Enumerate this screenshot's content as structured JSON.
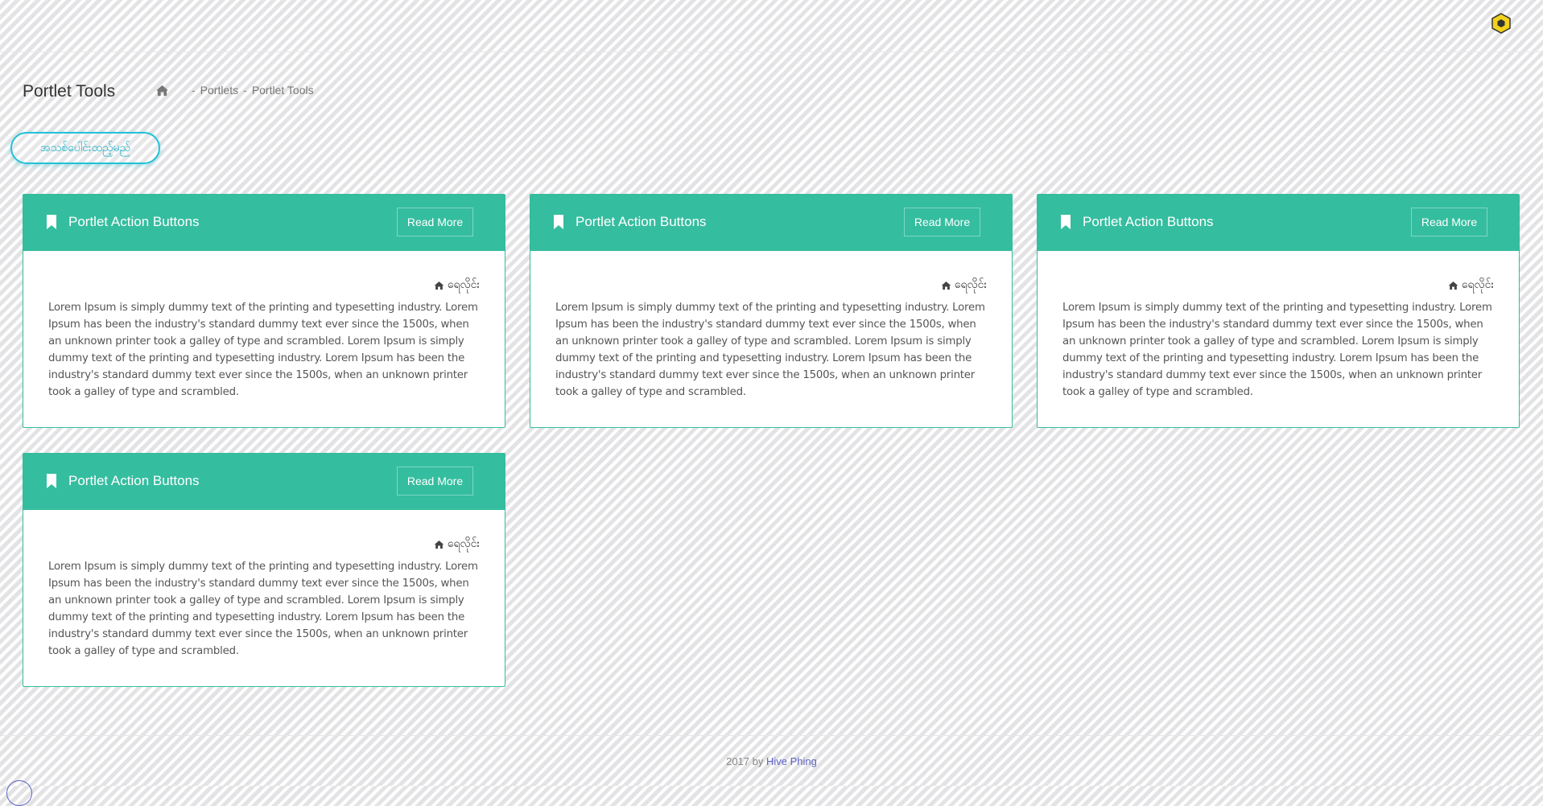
{
  "header": {
    "logo_icon": "hexagon-icon",
    "accent": "#f2d21b"
  },
  "page": {
    "title": "Portlet Tools",
    "breadcrumb": {
      "home_icon": "home-icon",
      "separator": "-",
      "items": [
        "Portlets",
        "Portlet Tools"
      ]
    },
    "action_button": "အသစ်ပေါင်းထည့်မည်"
  },
  "colors": {
    "card_header": "#35bd9f",
    "pill_border": "#22c2d6",
    "link": "#5d63c4"
  },
  "cards": [
    {
      "title": "Portlet Action Buttons",
      "button": "Read More",
      "home_label": "ရေလိုင်း",
      "text": "Lorem Ipsum is simply dummy text of the printing and typesetting industry. Lorem Ipsum has been the industry's standard dummy text ever since the 1500s, when an unknown printer took a galley of type and scrambled. Lorem Ipsum is simply dummy text of the printing and typesetting industry. Lorem Ipsum has been the industry's standard dummy text ever since the 1500s, when an unknown printer took a galley of type and scrambled."
    },
    {
      "title": "Portlet Action Buttons",
      "button": "Read More",
      "home_label": "ရေလိုင်း",
      "text": "Lorem Ipsum is simply dummy text of the printing and typesetting industry. Lorem Ipsum has been the industry's standard dummy text ever since the 1500s, when an unknown printer took a galley of type and scrambled. Lorem Ipsum is simply dummy text of the printing and typesetting industry. Lorem Ipsum has been the industry's standard dummy text ever since the 1500s, when an unknown printer took a galley of type and scrambled."
    },
    {
      "title": "Portlet Action Buttons",
      "button": "Read More",
      "home_label": "ရေလိုင်း",
      "text": "Lorem Ipsum is simply dummy text of the printing and typesetting industry. Lorem Ipsum has been the industry's standard dummy text ever since the 1500s, when an unknown printer took a galley of type and scrambled. Lorem Ipsum is simply dummy text of the printing and typesetting industry. Lorem Ipsum has been the industry's standard dummy text ever since the 1500s, when an unknown printer took a galley of type and scrambled."
    },
    {
      "title": "Portlet Action Buttons",
      "button": "Read More",
      "home_label": "ရေလိုင်း",
      "text": "Lorem Ipsum is simply dummy text of the printing and typesetting industry. Lorem Ipsum has been the industry's standard dummy text ever since the 1500s, when an unknown printer took a galley of type and scrambled. Lorem Ipsum is simply dummy text of the printing and typesetting industry. Lorem Ipsum has been the industry's standard dummy text ever since the 1500s, when an unknown printer took a galley of type and scrambled."
    }
  ],
  "footer": {
    "prefix": "2017 by",
    "link": "Hive Phing"
  }
}
